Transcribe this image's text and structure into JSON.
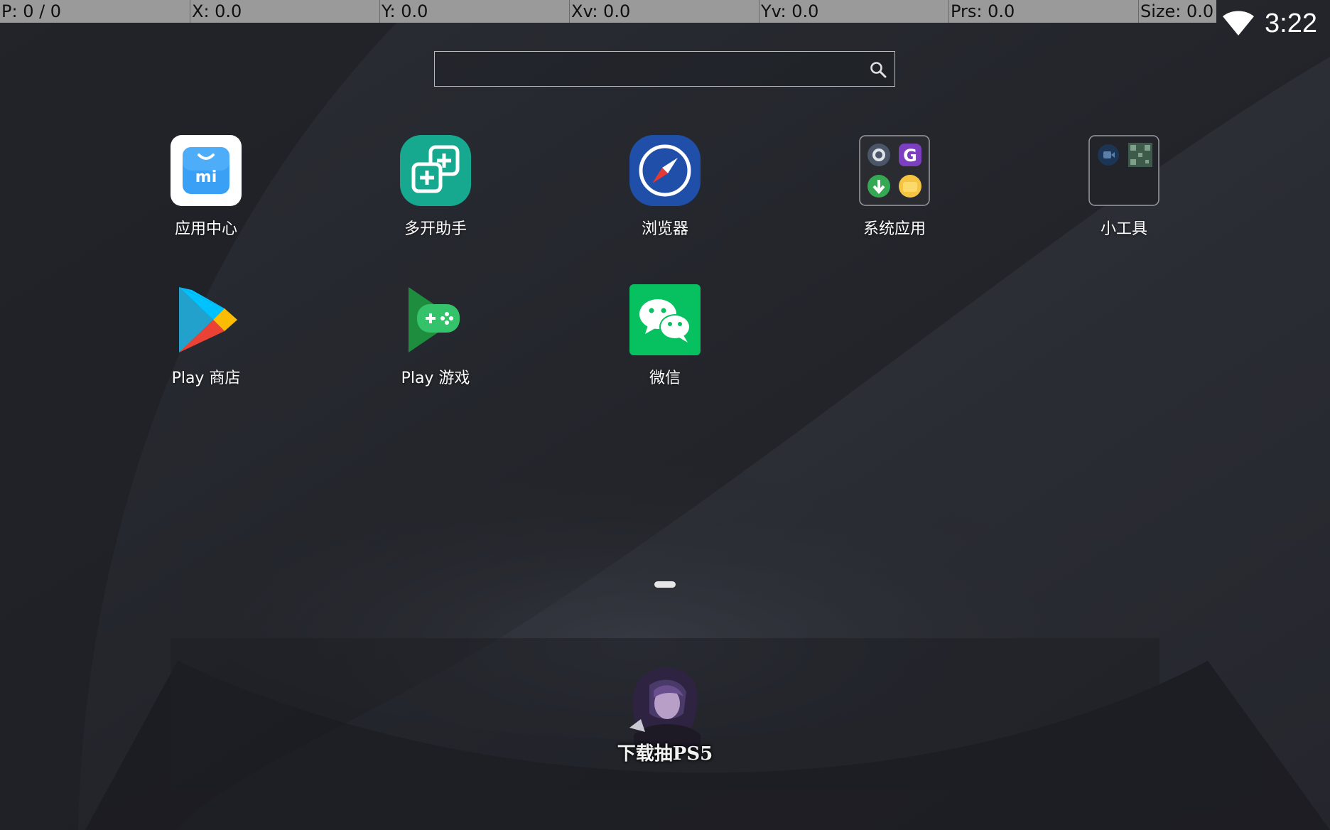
{
  "debug_bar": {
    "pointer": "P: 0 / 0",
    "x": "X: 0.0",
    "y": "Y: 0.0",
    "xv": "Xv: 0.0",
    "yv": "Yv: 0.0",
    "prs": "Prs: 0.0",
    "size": "Size: 0.0"
  },
  "status_bar": {
    "wifi_icon": "wifi-icon",
    "time": "3:22"
  },
  "search": {
    "value": "",
    "placeholder": "",
    "icon": "search-icon"
  },
  "apps": [
    {
      "label": "应用中心",
      "icon": "mi-app-store-icon",
      "color": "#3aa0f5"
    },
    {
      "label": "多开助手",
      "icon": "multi-open-icon",
      "color": "#16a98f"
    },
    {
      "label": "浏览器",
      "icon": "compass-browser-icon",
      "color": "#1f4fa8"
    },
    {
      "label": "系统应用",
      "icon": "system-apps-folder-icon",
      "color": "#2a2c32"
    },
    {
      "label": "小工具",
      "icon": "tools-folder-icon",
      "color": "#2a2c32"
    },
    {
      "label": "Play 商店",
      "icon": "play-store-icon",
      "color": "#34a853"
    },
    {
      "label": "Play 游戏",
      "icon": "play-games-icon",
      "color": "#1e8e3e"
    },
    {
      "label": "微信",
      "icon": "wechat-icon",
      "color": "#07c160"
    }
  ],
  "dock": {
    "promo_text": "下载抽PS5"
  }
}
